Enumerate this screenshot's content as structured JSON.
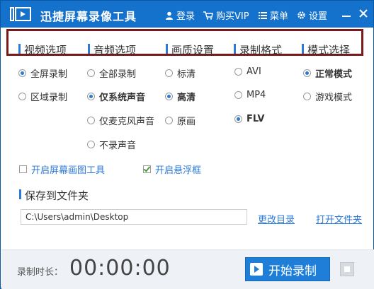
{
  "app": {
    "title": "迅捷屏幕录像工具"
  },
  "titlebar": {
    "login": "登录",
    "vip": "购买VIP",
    "menu": "菜单",
    "settings": "设置"
  },
  "tabs": [
    "视频选项",
    "音频选项",
    "画质设置",
    "录制格式",
    "模式选择"
  ],
  "video": {
    "fullscreen": "全屏录制",
    "region": "区域录制"
  },
  "audio": {
    "all": "全部录制",
    "system_only": "仅系统声音",
    "mic_only": "仅麦克风声音",
    "none": "不录声音"
  },
  "quality": {
    "standard": "标清",
    "high": "高清",
    "original": "原画"
  },
  "format": {
    "avi": "AVI",
    "mp4": "MP4",
    "flv": "FLV"
  },
  "mode": {
    "normal": "正常模式",
    "game": "游戏模式"
  },
  "checks": {
    "draw_tool": "开启屏幕画图工具",
    "float_box": "开启悬浮框"
  },
  "save": {
    "title": "保存到文件夹",
    "path": "C:\\Users\\admin\\Desktop",
    "change_dir": "更改目录",
    "open_dir": "打开文件夹"
  },
  "footer": {
    "duration_label": "录制时长：",
    "duration": "00:00:00",
    "start": "开始录制"
  },
  "colors": {
    "titlebar": "#1572cc",
    "accent": "#2c7ad6",
    "tab_border": "#7a1a1a"
  }
}
